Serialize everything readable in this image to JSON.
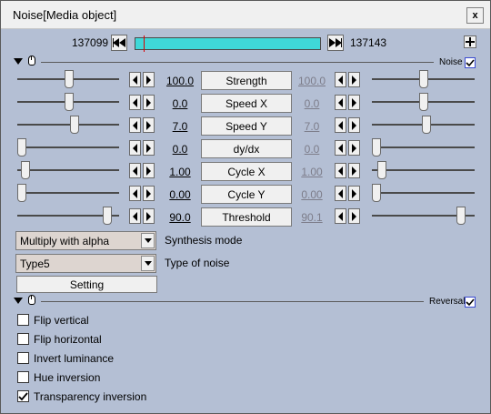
{
  "window": {
    "title": "Noise[Media object]",
    "close_label": "x"
  },
  "frames": {
    "start": "137099",
    "end": "137143"
  },
  "noise_section": {
    "label": "Noise",
    "checked": true
  },
  "params": [
    {
      "value": "100.0",
      "label": "Strength",
      "end_value": "100.0"
    },
    {
      "value": "0.0",
      "label": "Speed X",
      "end_value": "0.0"
    },
    {
      "value": "7.0",
      "label": "Speed Y",
      "end_value": "7.0"
    },
    {
      "value": "0.0",
      "label": "dy/dx",
      "end_value": "0.0"
    },
    {
      "value": "1.00",
      "label": "Cycle X",
      "end_value": "1.00"
    },
    {
      "value": "0.00",
      "label": "Cycle Y",
      "end_value": "0.00"
    },
    {
      "value": "90.0",
      "label": "Threshold",
      "end_value": "90.1"
    }
  ],
  "synthesis": {
    "selected": "Multiply with alpha",
    "label": "Synthesis mode"
  },
  "noise_type": {
    "selected": "Type5",
    "label": "Type of noise"
  },
  "setting_label": "Setting",
  "reversal_section": {
    "label": "Reversal",
    "checked": true
  },
  "options": [
    {
      "label": "Flip vertical",
      "checked": false
    },
    {
      "label": "Flip horizontal",
      "checked": false
    },
    {
      "label": "Invert luminance",
      "checked": false
    },
    {
      "label": "Hue inversion",
      "checked": false
    },
    {
      "label": "Transparency inversion",
      "checked": true
    }
  ]
}
